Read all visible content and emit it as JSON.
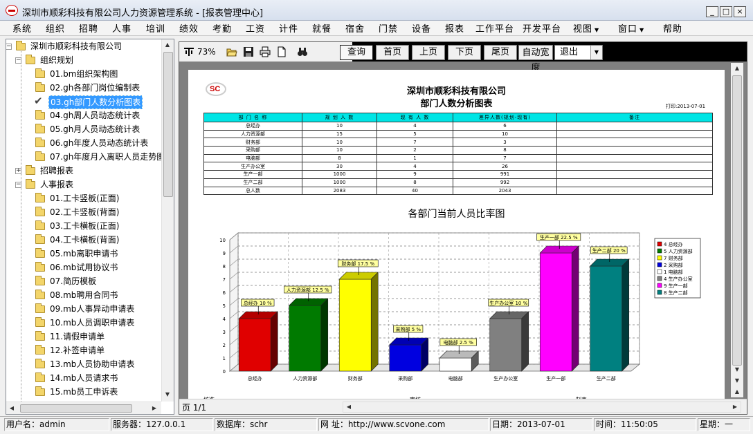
{
  "window": {
    "title": "深圳市顺彩科技有限公司人力资源管理系统 - [报表管理中心]",
    "controls": [
      "_",
      "□",
      "×"
    ]
  },
  "menu": [
    {
      "label": "系统"
    },
    {
      "label": "组织"
    },
    {
      "label": "招聘"
    },
    {
      "label": "人事"
    },
    {
      "label": "培训"
    },
    {
      "label": "绩效"
    },
    {
      "label": "考勤"
    },
    {
      "label": "工资"
    },
    {
      "label": "计件"
    },
    {
      "label": "就餐"
    },
    {
      "label": "宿舍"
    },
    {
      "label": "门禁"
    },
    {
      "label": "设备"
    },
    {
      "label": "报表"
    },
    {
      "label": "工作平台"
    },
    {
      "label": "开发平台"
    },
    {
      "label": "视图",
      "dropdown": true
    },
    {
      "label": "窗口",
      "dropdown": true
    },
    {
      "label": "帮助"
    }
  ],
  "tree": {
    "root": "深圳市顺彩科技有限公司",
    "groups": [
      {
        "label": "组织规划",
        "expanded": true,
        "items": [
          "01.bm组织架构图",
          "02.gh各部门岗位编制表",
          "03.gh部门人数分析图表",
          "04.gh周人员动态统计表",
          "05.gh月人员动态统计表",
          "06.gh年度人员动态统计表",
          "07.gh年度月入离职人员走势图"
        ],
        "selected_index": 2
      },
      {
        "label": "招聘报表",
        "expanded": false,
        "items": []
      },
      {
        "label": "人事报表",
        "expanded": true,
        "items": [
          "01.工卡竖板(正面)",
          "02.工卡竖板(背面)",
          "03.工卡横板(正面)",
          "04.工卡横板(背面)",
          "05.mb离职申请书",
          "06.mb试用协议书",
          "07.简历模板",
          "08.mb聘用合同书",
          "09.mb人事异动申请表",
          "10.mb人员调职申请表",
          "11.请假申请单",
          "12.补签申请单",
          "13.mb人员协助申请表",
          "14.mb人员请求书",
          "15.mb员工申诉表"
        ]
      }
    ]
  },
  "toolbar": {
    "zoom": "73%",
    "buttons": [
      "查询",
      "首页",
      "上页",
      "下页",
      "尾页"
    ],
    "auto_width": "自动宽度",
    "exit_select": "退出"
  },
  "report": {
    "company": "深圳市顺彩科技有限公司",
    "title": "部门人数分析图表",
    "print_date": "打印:2013-07-01",
    "columns": [
      "部 门 名 称",
      "规 划 人 数",
      "现 有 人 数",
      "差异人数(规划-现有)",
      "备注"
    ],
    "rows": [
      [
        "总经办",
        "10",
        "4",
        "6",
        ""
      ],
      [
        "人力资源部",
        "15",
        "5",
        "10",
        ""
      ],
      [
        "财务部",
        "10",
        "7",
        "3",
        ""
      ],
      [
        "采购部",
        "10",
        "2",
        "8",
        ""
      ],
      [
        "电脑部",
        "8",
        "1",
        "7",
        ""
      ],
      [
        "生产办公室",
        "30",
        "4",
        "26",
        ""
      ],
      [
        "生产一部",
        "1000",
        "9",
        "991",
        ""
      ],
      [
        "生产二部",
        "1000",
        "8",
        "992",
        ""
      ],
      [
        "总人数",
        "2083",
        "40",
        "2043",
        ""
      ]
    ],
    "footer_labels": [
      "核准:",
      "审核:",
      "制表:"
    ]
  },
  "chart_data": {
    "type": "bar",
    "title": "各部门当前人员比率图",
    "categories": [
      "总经办",
      "人力资源部",
      "财务部",
      "采购部",
      "电脑部",
      "生产办公室",
      "生产一部",
      "生产二部"
    ],
    "values": [
      4,
      5,
      7,
      2,
      1,
      4,
      9,
      8
    ],
    "data_labels": [
      "总经办 10 %",
      "人力资源部 12.5 %",
      "财务部 17.5 %",
      "采购部 5 %",
      "电脑部 2.5 %",
      "生产办公室 10 %",
      "生产一部 22.5 %",
      "生产二部 20 %"
    ],
    "legend": [
      "4 总经办",
      "5 人力资源部",
      "7 财务部",
      "2 采购部",
      "1 电脑部",
      "4 生产办公室",
      "9 生产一部",
      "8 生产二部"
    ],
    "colors": [
      "#e00000",
      "#007a00",
      "#ffff00",
      "#0000e0",
      "#ffffff",
      "#808080",
      "#ff00ff",
      "#008080"
    ],
    "ylim": [
      0,
      10
    ],
    "yticks": [
      "0",
      "1",
      "2",
      "3",
      "4",
      "5",
      "6",
      "7",
      "8",
      "9",
      "10"
    ],
    "grid": true,
    "legend_position": "right"
  },
  "pagination": {
    "label": "页 1/1"
  },
  "status": {
    "user": "用户名：admin",
    "server": "服务器：127.0.0.1",
    "database": "数据库：schr",
    "website": "网  址：http://www.scvone.com",
    "date": "日期：2013-07-01",
    "time": "时间：11:50:05",
    "weekday": "星期：一"
  }
}
